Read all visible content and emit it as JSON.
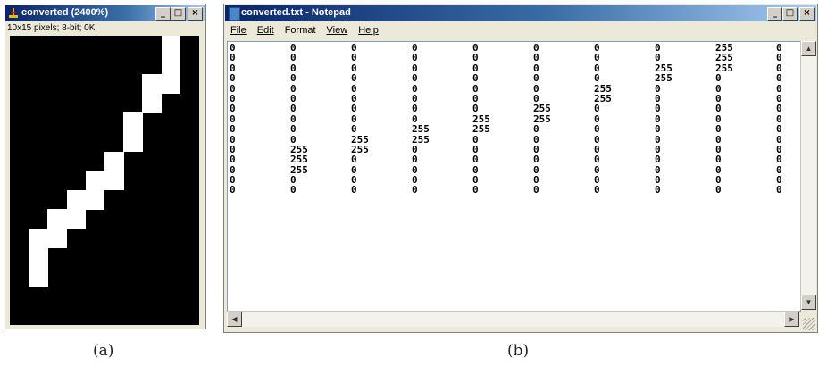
{
  "window_a": {
    "title": "converted (2400%)",
    "info": "10x15 pixels; 8-bit; 0K",
    "buttons": [
      "_",
      "□",
      "×"
    ],
    "icon": "imagej-icon",
    "grid_cols": 10,
    "grid_rows": 15,
    "pixels": [
      [
        0,
        0,
        0,
        0,
        0,
        0,
        0,
        0,
        255,
        0
      ],
      [
        0,
        0,
        0,
        0,
        0,
        0,
        0,
        0,
        255,
        0
      ],
      [
        0,
        0,
        0,
        0,
        0,
        0,
        0,
        255,
        255,
        0
      ],
      [
        0,
        0,
        0,
        0,
        0,
        0,
        0,
        255,
        0,
        0
      ],
      [
        0,
        0,
        0,
        0,
        0,
        0,
        255,
        0,
        0,
        0
      ],
      [
        0,
        0,
        0,
        0,
        0,
        0,
        255,
        0,
        0,
        0
      ],
      [
        0,
        0,
        0,
        0,
        0,
        255,
        0,
        0,
        0,
        0
      ],
      [
        0,
        0,
        0,
        0,
        255,
        255,
        0,
        0,
        0,
        0
      ],
      [
        0,
        0,
        0,
        255,
        255,
        0,
        0,
        0,
        0,
        0
      ],
      [
        0,
        0,
        255,
        255,
        0,
        0,
        0,
        0,
        0,
        0
      ],
      [
        0,
        255,
        255,
        0,
        0,
        0,
        0,
        0,
        0,
        0
      ],
      [
        0,
        255,
        0,
        0,
        0,
        0,
        0,
        0,
        0,
        0
      ],
      [
        0,
        255,
        0,
        0,
        0,
        0,
        0,
        0,
        0,
        0
      ],
      [
        0,
        0,
        0,
        0,
        0,
        0,
        0,
        0,
        0,
        0
      ],
      [
        0,
        0,
        0,
        0,
        0,
        0,
        0,
        0,
        0,
        0
      ]
    ]
  },
  "window_b": {
    "title": "converted.txt - Notepad",
    "icon": "notepad-icon",
    "buttons": [
      "_",
      "□",
      "×"
    ],
    "menu": [
      "File",
      "Edit",
      "Format",
      "View",
      "Help"
    ]
  },
  "captions": {
    "a": "(a)",
    "b": "(b)"
  },
  "colors": {
    "titlebar": "#0a246a",
    "pixel_on": "#ffffff",
    "pixel_off": "#000000"
  }
}
